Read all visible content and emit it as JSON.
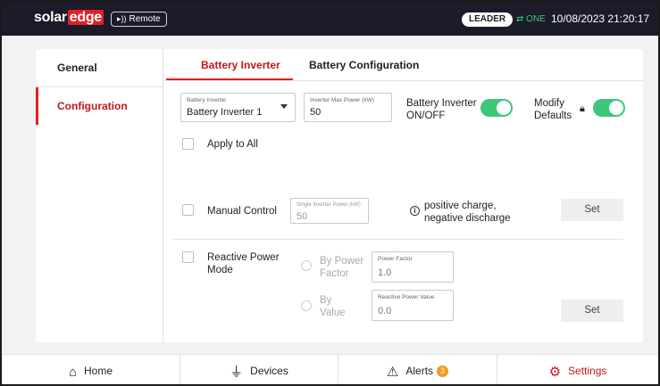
{
  "header": {
    "logo_part1": "solar",
    "logo_part2": "edge",
    "remote_label": "Remote",
    "leader_label": "LEADER",
    "connection_label": "ONE",
    "datetime": "10/08/2023 21:20:17"
  },
  "sidebar": {
    "items": [
      {
        "label": "General"
      },
      {
        "label": "Configuration"
      }
    ]
  },
  "tabs": [
    {
      "label": "Battery Inverter"
    },
    {
      "label": "Battery Configuration"
    }
  ],
  "form": {
    "inverter_select": {
      "label": "Battery Inverter",
      "value": "Battery Inverter 1"
    },
    "max_power": {
      "label": "Inverter Max Power (kW)",
      "value": "50"
    },
    "onoff_label_1": "Battery Inverter",
    "onoff_label_2": "ON/OFF",
    "modify_label_1": "Modify",
    "modify_label_2": "Defaults",
    "apply_all_label": "Apply to All",
    "manual_control_label": "Manual Control",
    "single_power": {
      "label": "Single Inverter Power (kW)",
      "value": "50"
    },
    "info_line_1": "positive charge,",
    "info_line_2": "negative discharge",
    "set_label_1": "Set",
    "reactive_label_1": "Reactive Power",
    "reactive_label_2": "Mode",
    "by_pf_1": "By Power",
    "by_pf_2": "Factor",
    "power_factor": {
      "label": "Power Factor",
      "value": "1.0"
    },
    "by_value_1": "By",
    "by_value_2": "Value",
    "reactive_value": {
      "label": "Reactive Power Value",
      "value": "0.0"
    },
    "set_label_2": "Set"
  },
  "bottom_nav": {
    "home": "Home",
    "devices": "Devices",
    "alerts": "Alerts",
    "alerts_count": "3",
    "settings": "Settings"
  },
  "colors": {
    "brand_red": "#e31e24",
    "toggle_green": "#3ec77b",
    "alert_orange": "#f29a1e",
    "header_bg": "#1b1b2a"
  }
}
